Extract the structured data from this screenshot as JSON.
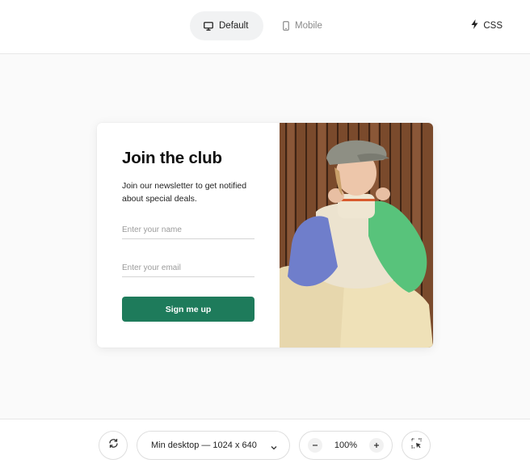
{
  "topbar": {
    "tabs": [
      {
        "label": "Default",
        "icon": "desktop-icon",
        "active": true
      },
      {
        "label": "Mobile",
        "icon": "mobile-icon",
        "active": false
      }
    ],
    "css_label": "CSS"
  },
  "card": {
    "title": "Join the club",
    "description": "Join our newsletter to get notified about special deals.",
    "name_placeholder": "Enter your name",
    "email_placeholder": "Enter your email",
    "button_label": "Sign me up",
    "button_color": "#1e7b5b"
  },
  "bottombar": {
    "device_label": "Min desktop — 1024 x 640",
    "zoom_value": "100%"
  }
}
